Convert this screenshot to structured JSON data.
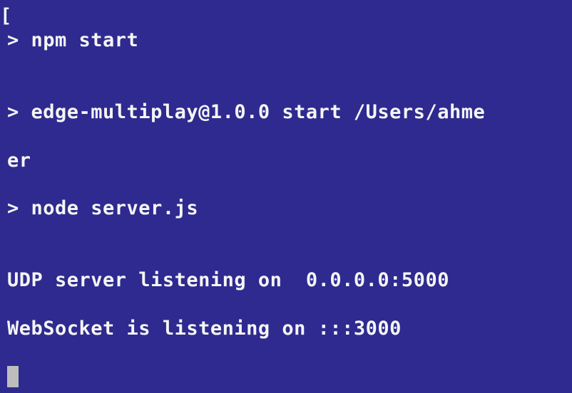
{
  "terminal": {
    "lines": [
      "> npm start",
      "",
      "> edge-multiplay@1.0.0 start /Users/ahme",
      "er",
      "> node server.js",
      "",
      "UDP server listening on  0.0.0.0:5000",
      "WebSocket is listening on :::3000"
    ],
    "left_bracket": "[",
    "colors": {
      "background": "#2e2a8f",
      "foreground": "#f5f5f5",
      "cursor": "#bdbdbd"
    }
  }
}
